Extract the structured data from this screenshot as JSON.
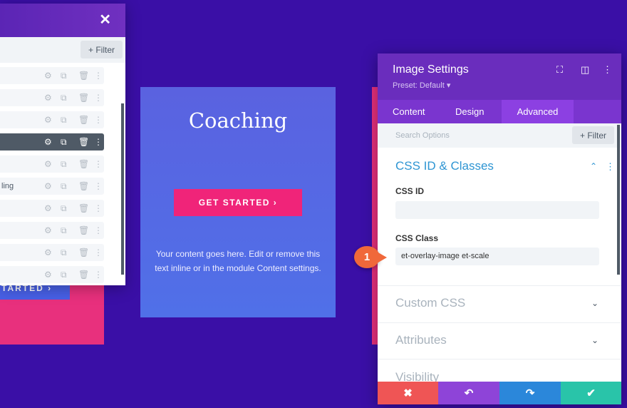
{
  "layers_panel": {
    "filter_label": "+ Filter",
    "rows": [
      "",
      "",
      "",
      "",
      "",
      "ling",
      "",
      "",
      "",
      ""
    ],
    "active_row": 3
  },
  "behind_button": "TARTED ›",
  "card": {
    "title": "Coaching",
    "button": "GET STARTED  ›",
    "text": "Your content goes here. Edit or remove this text inline or in the module Content settings."
  },
  "settings": {
    "title": "Image Settings",
    "preset": "Preset: Default ▾",
    "tabs": [
      "Content",
      "Design",
      "Advanced"
    ],
    "active_tab": "Advanced",
    "search_placeholder": "Search Options",
    "filter_label": "+ Filter",
    "section_open": "CSS ID & Classes",
    "css_id_label": "CSS ID",
    "css_id_value": "",
    "css_class_label": "CSS Class",
    "css_class_value": "et-overlay-image et-scale",
    "sections": [
      "Custom CSS",
      "Attributes",
      "Visibility"
    ]
  },
  "footer": {
    "cancel": "✖",
    "undo": "↶",
    "redo": "↷",
    "save": "✔",
    "colors": [
      "#ef5555",
      "#8e44d8",
      "#2b87da",
      "#29c4a9"
    ]
  },
  "badge": "1"
}
